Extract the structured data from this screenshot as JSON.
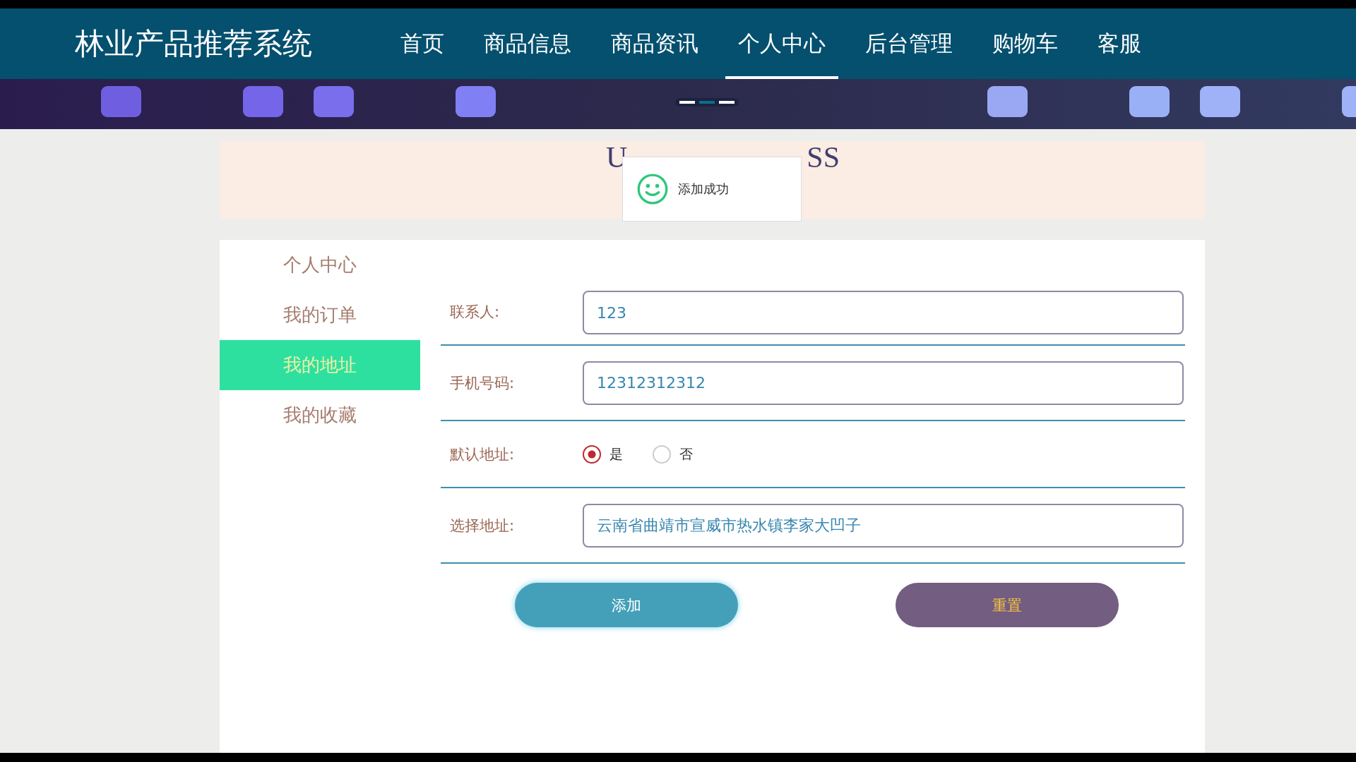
{
  "header": {
    "site_title": "林业产品推荐系统",
    "nav": [
      {
        "label": "首页",
        "selected": false
      },
      {
        "label": "商品信息",
        "selected": false
      },
      {
        "label": "商品资讯",
        "selected": false
      },
      {
        "label": "个人中心",
        "selected": true
      },
      {
        "label": "后台管理",
        "selected": false
      },
      {
        "label": "购物车",
        "selected": false
      },
      {
        "label": "客服",
        "selected": false
      }
    ]
  },
  "banner": {
    "kind": "picture",
    "indicators": [
      {
        "selected": false
      },
      {
        "selected": true
      },
      {
        "selected": false
      }
    ]
  },
  "section_title_fragments": [
    "U",
    "SS"
  ],
  "toast": {
    "message": "添加成功"
  },
  "sidebar": {
    "items": [
      {
        "label": "个人中心",
        "selected": false
      },
      {
        "label": "我的订单",
        "selected": false
      },
      {
        "label": "我的地址",
        "selected": true
      },
      {
        "label": "我的收藏",
        "selected": false
      }
    ]
  },
  "form": {
    "fields": [
      {
        "kind": "text",
        "label": "联系人:",
        "value": "123"
      },
      {
        "kind": "text",
        "label": "手机号码:",
        "value": "12312312312"
      },
      {
        "kind": "radio",
        "label": "默认地址:",
        "options": [
          {
            "label": "是",
            "selected": true
          },
          {
            "label": "否",
            "selected": false
          }
        ]
      },
      {
        "kind": "text",
        "label": "选择地址:",
        "value": "云南省曲靖市宣威市热水镇李家大凹子"
      }
    ],
    "buttons": [
      {
        "kind": "primary",
        "label": "添加"
      },
      {
        "kind": "secondary",
        "label": "重置"
      }
    ]
  }
}
